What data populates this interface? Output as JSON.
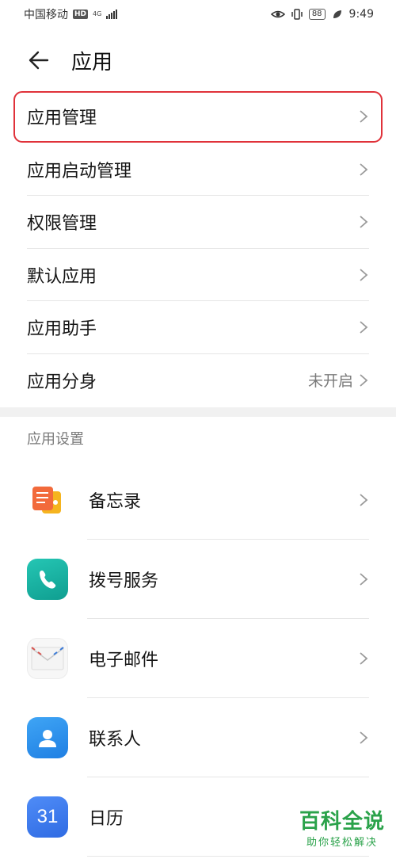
{
  "status_bar": {
    "carrier": "中国移动",
    "hd": "HD",
    "network_top": "4G",
    "network_bottom": "",
    "battery": "88",
    "time": "9:49"
  },
  "header": {
    "back_icon": "arrow-left-icon",
    "title": "应用"
  },
  "menu": {
    "items": [
      {
        "label": "应用管理",
        "value": ""
      },
      {
        "label": "应用启动管理",
        "value": ""
      },
      {
        "label": "权限管理",
        "value": ""
      },
      {
        "label": "默认应用",
        "value": ""
      },
      {
        "label": "应用助手",
        "value": ""
      },
      {
        "label": "应用分身",
        "value": "未开启"
      }
    ]
  },
  "app_settings": {
    "section_title": "应用设置",
    "apps": [
      {
        "label": "备忘录",
        "icon": "memo-icon"
      },
      {
        "label": "拨号服务",
        "icon": "phone-icon"
      },
      {
        "label": "电子邮件",
        "icon": "mail-icon"
      },
      {
        "label": "联系人",
        "icon": "contacts-icon"
      },
      {
        "label": "日历",
        "icon": "calendar-icon",
        "icon_text": "31"
      }
    ]
  },
  "watermark": {
    "title": "百科全说",
    "subtitle": "助你轻松解决"
  },
  "colors": {
    "highlight": "#e0323a",
    "watermark": "#2aa24a",
    "divider": "#e6e6e6"
  }
}
